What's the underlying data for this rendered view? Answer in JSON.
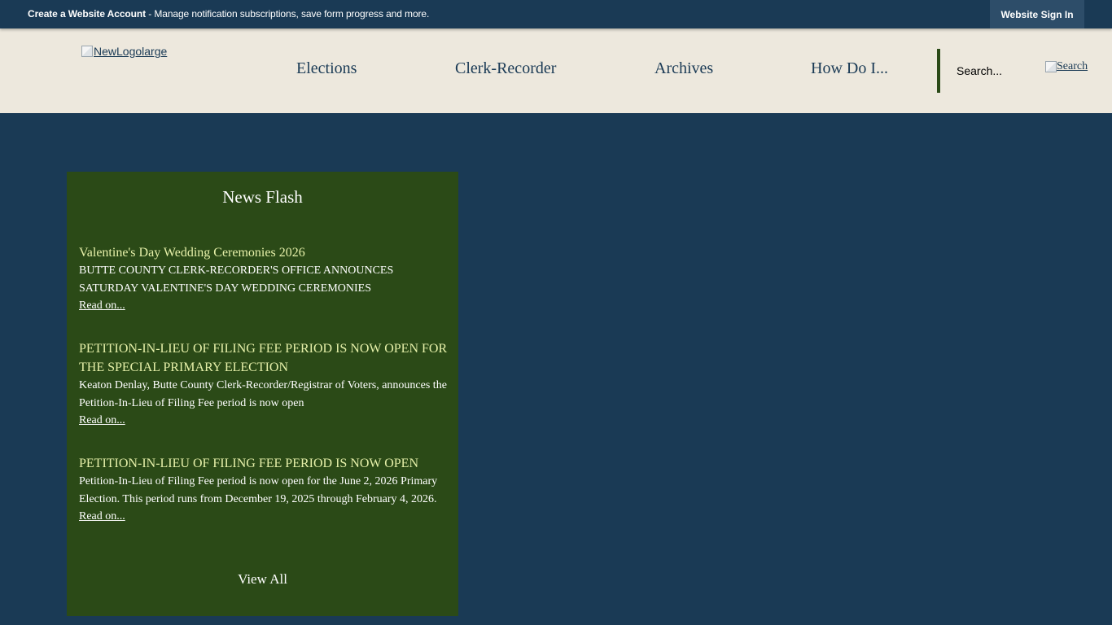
{
  "topbar": {
    "promo_bold": "Create a Website Account",
    "promo_text": " - Manage notification subscriptions, save form progress and more.",
    "signin_label": "Website Sign In"
  },
  "header": {
    "logo_alt": "NewLogolarge",
    "nav": [
      "Elections",
      "Clerk-Recorder",
      "Archives",
      "How Do I..."
    ],
    "search_placeholder": "Search...",
    "search_button_alt": "Search"
  },
  "news_flash": {
    "title": "News Flash",
    "articles": [
      {
        "title": "Valentine's Day Wedding Ceremonies 2026",
        "description": "BUTTE COUNTY CLERK-RECORDER'S OFFICE ANNOUNCES SATURDAY VALENTINE'S DAY WEDDING CEREMONIES",
        "read_on": "Read on..."
      },
      {
        "title": "PETITION-IN-LIEU OF FILING FEE PERIOD IS NOW OPEN FOR THE SPECIAL PRIMARY ELECTION",
        "description": "Keaton Denlay, Butte County Clerk-Recorder/Registrar of Voters, announces the Petition-In-Lieu of Filing Fee period is now open",
        "read_on": "Read on..."
      },
      {
        "title": "PETITION-IN-LIEU OF FILING FEE PERIOD IS NOW OPEN",
        "description": "Petition-In-Lieu of Filing Fee period is now open for the June 2, 2026 Primary Election. This period runs from December 19, 2025 through February 4, 2026.",
        "read_on": "Read on..."
      }
    ],
    "view_all": "View All"
  },
  "colors": {
    "page_bg": "#1a3a55",
    "header_bg": "#ede8dd",
    "news_bg": "#2b4a17",
    "news_title_link": "#e6f0a9"
  },
  "icons": {
    "logo": "broken-image-icon",
    "search": "broken-image-icon"
  }
}
